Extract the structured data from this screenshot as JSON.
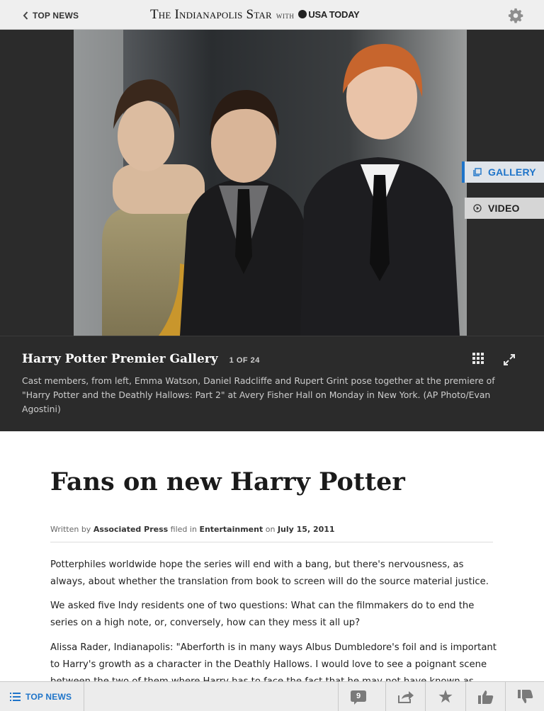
{
  "topbar": {
    "back_label": "TOP NEWS",
    "masthead_title": "The Indianapolis Star",
    "masthead_with": "WITH",
    "masthead_partner": "USA TODAY",
    "settings_icon": "gear-icon"
  },
  "media_tabs": {
    "gallery_label": "GALLERY",
    "video_label": "VIDEO",
    "active": "gallery",
    "accent_color": "#1e74c9"
  },
  "caption": {
    "title": "Harry Potter Premier Gallery",
    "counter": "1 OF 24",
    "text": "Cast members, from left, Emma Watson, Daniel Radcliffe and Rupert Grint pose together at the premiere of \"Harry Potter and the Deathly Hallows: Part 2\" at Avery Fisher Hall on Monday in New York. (AP Photo/Evan Agostini)",
    "grid_icon": "grid-icon",
    "expand_icon": "expand-icon"
  },
  "article": {
    "headline": "Fans on new Harry Potter",
    "byline_written": "Written by",
    "byline_author": "Associated Press",
    "byline_filed": "filed in",
    "byline_section": "Entertainment",
    "byline_on": "on",
    "byline_date": "July 15, 2011",
    "paragraphs": [
      "Potterphiles worldwide hope the series will end with a bang, but there's nervousness, as always, about whether the translation from book to screen will do the source material justice.",
      "We asked five Indy residents one of two questions: What can the filmmakers do to end the series on a high note, or, conversely, how can they mess it all up?",
      "Alissa Rader, Indianapolis: \"Aberforth is in many ways Albus Dumbledore's foil and is important to Harry's growth as a character in the Deathly Hallows. I would love to see a poignant scene between the two of them where Harry has to face the fact that he may not have known as"
    ]
  },
  "bottombar": {
    "topnews_label": "TOP NEWS",
    "comment_count": "9",
    "icons": [
      "comments-icon",
      "share-icon",
      "star-icon",
      "thumbs-up-icon",
      "thumbs-down-icon"
    ]
  }
}
